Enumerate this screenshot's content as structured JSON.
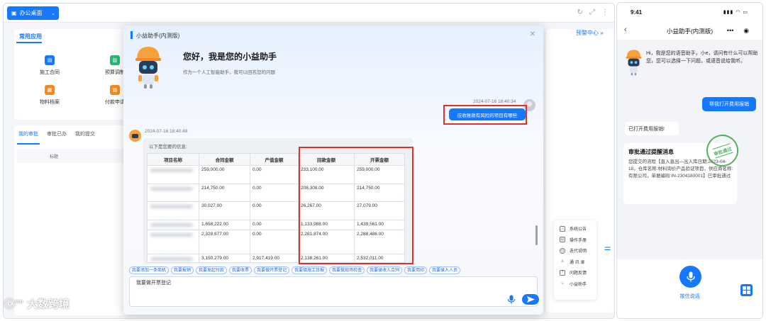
{
  "desktop": {
    "workspace_label": "办公桌面",
    "apps_title": "常用应用",
    "apps": [
      {
        "label": "施工合同",
        "icon": "contract-icon",
        "color": "#1677ff"
      },
      {
        "label": "预算调制",
        "icon": "budget-icon",
        "color": "#2bb673"
      },
      {
        "label": "物料档案",
        "icon": "material-icon",
        "color": "#f08a24"
      },
      {
        "label": "付款申请",
        "icon": "payment-icon",
        "color": "#f08a24"
      }
    ],
    "approval_tabs": [
      "我的审批",
      "审批已办",
      "我的提交"
    ],
    "approval_header": "标题",
    "warning_link": "预警中心 »",
    "float_menu": [
      "系统公告",
      "操作手册",
      "迭代说明",
      "通 讯 录",
      "问题反馈",
      "小益助手"
    ]
  },
  "assistant": {
    "window_title": "小益助手(内测版)",
    "greeting_title": "您好，我是您的小益助手",
    "greeting_sub": "作为一个人工智能助手，我可以回答您的问题",
    "user_time": "2024-07-16 18:40:34",
    "user_message": "应收账款有风险的项目有哪些",
    "bot_time": "2024-07-16 18:40:48",
    "bot_intro": "以下是您要的信息:",
    "table": {
      "columns": [
        "项目名称",
        "合同金额",
        "产值金额",
        "回款金额",
        "开票金额"
      ],
      "rows": [
        [
          "",
          "259,000.00",
          "0.00",
          "233,100.00",
          "259,000.00"
        ],
        [
          "",
          "214,750.00",
          "0.00",
          "208,308.00",
          "214,750.00"
        ],
        [
          "",
          "30,027.00",
          "0.00",
          "26,267.00",
          "27,079.00"
        ],
        [
          "",
          "1,658,222.00",
          "0.00",
          "1,133,988.00",
          "1,439,561.00"
        ],
        [
          "",
          "2,328,677.00",
          "0.00",
          "2,281,874.00",
          "2,288,486.00"
        ],
        [
          "",
          "3,150,279.00",
          "2,917,419.00",
          "2,138,261.00",
          "2,532,011.00"
        ]
      ]
    },
    "quick_chips": [
      "我要添加一条商机",
      "我要报销",
      "我要发起付款",
      "我要收票",
      "我要做开票登记",
      "我要填施工日报",
      "我要做现场检查",
      "我要录收入合同",
      "我要用印",
      "我要录入人员"
    ],
    "input_value": "我要做开票登记"
  },
  "mobile": {
    "time": "9:41",
    "status_icons": "▮▮▮ ◠ ▭",
    "title": "小益助手(内测版)",
    "capsule": [
      "•••",
      "◉"
    ],
    "greeting": "Hi，我是您的语音助手，小e，请问有什么可以帮助您，您可以选择一下问题，或语音说给我听。",
    "user_message": "帮我打开费用报销",
    "bot_reply": "已打开费用报销!",
    "card_title": "审批通过提醒消息",
    "card_body": "您提交的流程【直入直出—出入库日期:2023-04-18，仓库名称:材料询价产品验证项目，供应商名称:                有限公司，单据编码:IN-2304180001】已审批通过",
    "stamp_text": "审批通过",
    "hold_to_talk": "按住说话"
  },
  "watermark": "大数跨境"
}
